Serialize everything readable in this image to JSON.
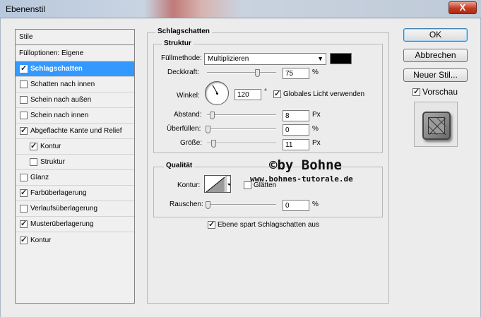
{
  "window": {
    "title": "Ebenenstil",
    "close_glyph": "X"
  },
  "sidebar": {
    "header": "Stile",
    "items": [
      {
        "label": "Fülloptionen: Eigene",
        "checkbox": false,
        "checked": false
      },
      {
        "label": "Schlagschatten",
        "checkbox": true,
        "checked": true,
        "selected": true
      },
      {
        "label": "Schatten nach innen",
        "checkbox": true,
        "checked": false
      },
      {
        "label": "Schein nach außen",
        "checkbox": true,
        "checked": false
      },
      {
        "label": "Schein nach innen",
        "checkbox": true,
        "checked": false
      },
      {
        "label": "Abgeflachte Kante und Relief",
        "checkbox": true,
        "checked": true
      },
      {
        "label": "Kontur",
        "checkbox": true,
        "checked": true,
        "indent": true
      },
      {
        "label": "Struktur",
        "checkbox": true,
        "checked": false,
        "indent": true
      },
      {
        "label": "Glanz",
        "checkbox": true,
        "checked": false
      },
      {
        "label": "Farbüberlagerung",
        "checkbox": true,
        "checked": true
      },
      {
        "label": "Verlaufsüberlagerung",
        "checkbox": true,
        "checked": false
      },
      {
        "label": "Musterüberlagerung",
        "checkbox": true,
        "checked": true
      },
      {
        "label": "Kontur",
        "checkbox": true,
        "checked": true
      }
    ]
  },
  "panel": {
    "title": "Schlagschatten",
    "structure": {
      "title": "Struktur",
      "blend_mode_label": "Füllmethode:",
      "blend_mode_value": "Multiplizieren",
      "shadow_color": "#000000",
      "opacity_label": "Deckkraft:",
      "opacity_value": "75",
      "opacity_unit": "%",
      "opacity_fraction": 0.75,
      "angle_label": "Winkel:",
      "angle_value": "120",
      "angle_unit": "°",
      "global_light_label": "Globales Licht verwenden",
      "global_light_checked": true,
      "distance_label": "Abstand:",
      "distance_value": "8",
      "distance_unit": "Px",
      "spread_label": "Überfüllen:",
      "spread_value": "0",
      "spread_unit": "%",
      "size_label": "Größe:",
      "size_value": "11",
      "size_unit": "Px"
    },
    "quality": {
      "title": "Qualität",
      "contour_label": "Kontur:",
      "antialias_label": "Glätten",
      "antialias_checked": false,
      "noise_label": "Rauschen:",
      "noise_value": "0",
      "noise_unit": "%"
    },
    "knockout_label": "Ebene spart Schlagschatten aus",
    "knockout_checked": true
  },
  "buttons": {
    "ok": "OK",
    "cancel": "Abbrechen",
    "new_style": "Neuer Stil...",
    "preview_label": "Vorschau",
    "preview_checked": true
  },
  "watermark": {
    "line1": "©by Bohne",
    "line2": "www.bohnes-tutorale.de"
  },
  "colors": {
    "selection": "#3399ff",
    "dialog_bg": "#ececec"
  }
}
